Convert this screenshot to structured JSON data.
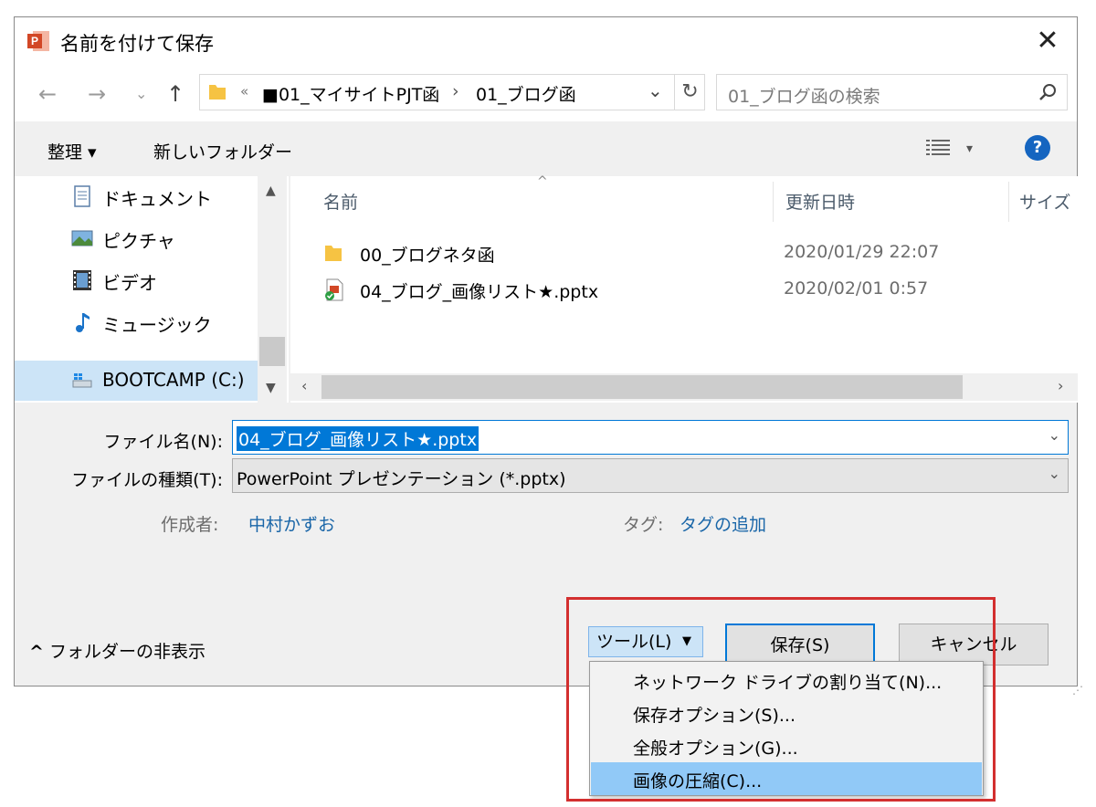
{
  "dialog": {
    "title": "名前を付けて保存",
    "close": "✕"
  },
  "nav": {
    "back": "←",
    "forward": "→",
    "recent": "⌄",
    "up": "↑",
    "path_overflow": "«",
    "path_segment_1": "■01_マイサイトPJT函",
    "path_sep": "›",
    "path_segment_2": "01_ブログ函",
    "refresh": "↻"
  },
  "search": {
    "placeholder": "01_ブログ函の検索"
  },
  "toolbar": {
    "organize": "整理 ▾",
    "new_folder": "新しいフォルダー",
    "view_dd": "▾",
    "help": "?"
  },
  "sidebar": {
    "items": [
      {
        "label": "ドキュメント",
        "icon": "document-icon"
      },
      {
        "label": "ピクチャ",
        "icon": "picture-icon"
      },
      {
        "label": "ビデオ",
        "icon": "video-icon"
      },
      {
        "label": "ミュージック",
        "icon": "music-icon"
      },
      {
        "label": "BOOTCAMP (C:)",
        "icon": "drive-icon",
        "selected": true
      }
    ]
  },
  "files": {
    "columns": {
      "name": "名前",
      "date": "更新日時",
      "size": "サイズ"
    },
    "sort_arrow": "^",
    "rows": [
      {
        "name": "00_ブログネタ函",
        "date": "2020/01/29 22:07",
        "type": "folder"
      },
      {
        "name": "04_ブログ_画像リスト★.pptx",
        "date": "2020/02/01 0:57",
        "type": "pptx"
      }
    ]
  },
  "form": {
    "filename_label": "ファイル名(N):",
    "filename_value": "04_ブログ_画像リスト★.pptx",
    "filetype_label": "ファイルの種類(T):",
    "filetype_value": "PowerPoint プレゼンテーション (*.pptx)",
    "author_label": "作成者:",
    "author_value": "中村かずお",
    "tags_label": "タグ:",
    "tags_value": "タグの追加",
    "chevron": "⌄"
  },
  "footer": {
    "hide_folders": "フォルダーの非表示",
    "hide_caret": "^",
    "tools": "ツール(L)",
    "tools_caret": "▼",
    "save": "保存(S)",
    "cancel": "キャンセル"
  },
  "tools_menu": {
    "items": [
      "ネットワーク ドライブの割り当て(N)...",
      "保存オプション(S)...",
      "全般オプション(G)...",
      "画像の圧縮(C)..."
    ],
    "highlighted_index": 3
  },
  "colors": {
    "accent": "#0078d7",
    "highlight_box": "#d32f2f",
    "link": "#1a66a8"
  }
}
